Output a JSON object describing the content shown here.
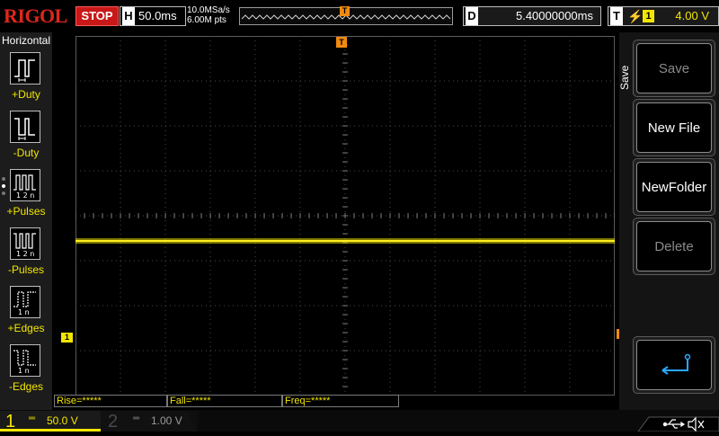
{
  "brand": "RIGOL",
  "run_state": "STOP",
  "horizontal": {
    "letter": "H",
    "timebase": "50.0ms",
    "sample_rate": "10.0MSa/s",
    "memory_depth": "6.00M pts",
    "marker": "T"
  },
  "delay": {
    "letter": "D",
    "value": "5.40000000ms"
  },
  "trigger": {
    "letter": "T",
    "edge_symbol": "⚡",
    "source": "1",
    "level": "4.00 V"
  },
  "left_menu": {
    "title": "Horizontal",
    "items": [
      {
        "label": "+Duty"
      },
      {
        "label": "-Duty"
      },
      {
        "label": "+Pulses"
      },
      {
        "label": "-Pulses"
      },
      {
        "label": "+Edges"
      },
      {
        "label": "-Edges"
      }
    ]
  },
  "right_menu": {
    "title": "Save",
    "buttons": [
      {
        "label": "Save",
        "enabled": false
      },
      {
        "label": "New File",
        "enabled": true
      },
      {
        "label": "NewFolder",
        "enabled": true
      },
      {
        "label": "Delete",
        "enabled": false
      }
    ],
    "back_icon": "return-arrow-icon"
  },
  "markers": {
    "ch1": "1",
    "trigger_level": "T",
    "trigger_position": "T"
  },
  "measurements": [
    {
      "label": "Rise=*****"
    },
    {
      "label": "Fall=*****"
    },
    {
      "label": "Freq=*****"
    }
  ],
  "channels": [
    {
      "number": "1",
      "coupling": "═",
      "scale": "50.0 V",
      "color": "#f2e600",
      "active": true
    },
    {
      "number": "2",
      "coupling": "═",
      "scale": "1.00 V",
      "color": "#00c8ff",
      "active": false
    }
  ],
  "status_icons": [
    "usb-icon",
    "speaker-muted-icon"
  ],
  "colors": {
    "ch1": "#f2e600",
    "trigger": "#f08a10",
    "stop": "#c81818",
    "brand": "#e0261b"
  }
}
